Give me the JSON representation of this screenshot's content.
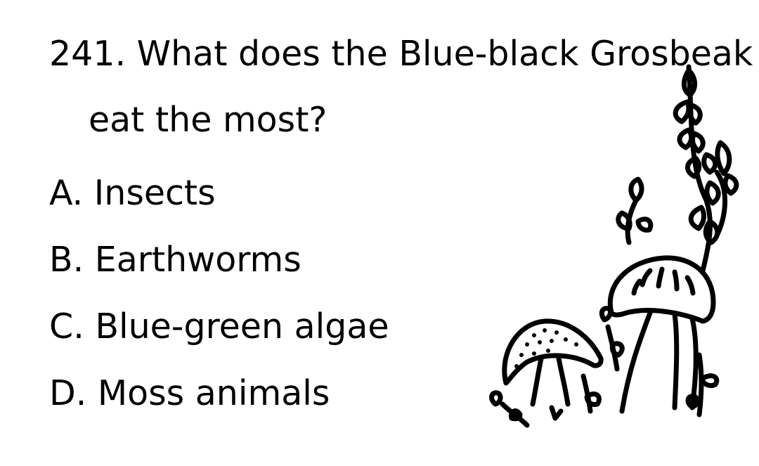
{
  "question": {
    "line1": "241. What does the Blue-black Grosbeak",
    "line2": "eat the most?"
  },
  "options": [
    {
      "label": "A. Insects"
    },
    {
      "label": "B. Earthworms"
    },
    {
      "label": "C. Blue-green algae"
    },
    {
      "label": "D. Moss animals"
    }
  ],
  "illustration": {
    "icon": "mushroom-plant-drawing-icon",
    "stroke_color": "#000000"
  }
}
